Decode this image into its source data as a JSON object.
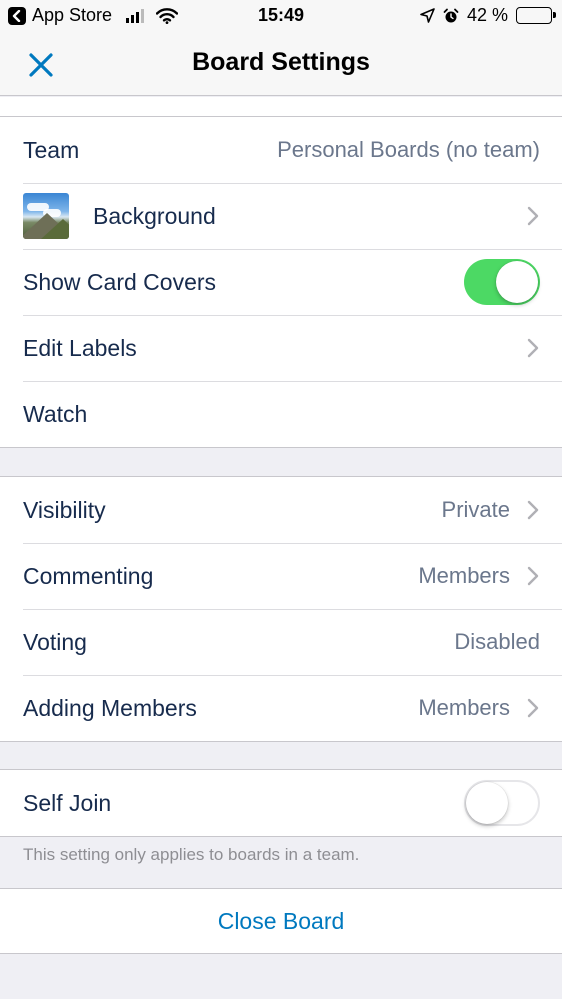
{
  "status_bar": {
    "back_app": "App Store",
    "time": "15:49",
    "battery_percent": "42 %",
    "battery_level": 0.42
  },
  "header": {
    "title": "Board Settings",
    "close_icon": "close-icon"
  },
  "settings_general": {
    "team_label": "Team",
    "team_value": "Personal Boards (no team)",
    "background_label": "Background",
    "show_card_covers_label": "Show Card Covers",
    "show_card_covers_on": true,
    "edit_labels_label": "Edit Labels",
    "watch_label": "Watch"
  },
  "settings_permissions": {
    "visibility_label": "Visibility",
    "visibility_value": "Private",
    "commenting_label": "Commenting",
    "commenting_value": "Members",
    "voting_label": "Voting",
    "voting_value": "Disabled",
    "adding_members_label": "Adding Members",
    "adding_members_value": "Members"
  },
  "self_join": {
    "label": "Self Join",
    "enabled": false,
    "footnote": "This setting only applies to boards in a team."
  },
  "close_board": {
    "label": "Close Board"
  },
  "colors": {
    "accent": "#0079bf",
    "toggle_on": "#4cd964",
    "text_primary": "#172b4d",
    "text_secondary": "#6b778c",
    "page_background": "#efeff4"
  }
}
